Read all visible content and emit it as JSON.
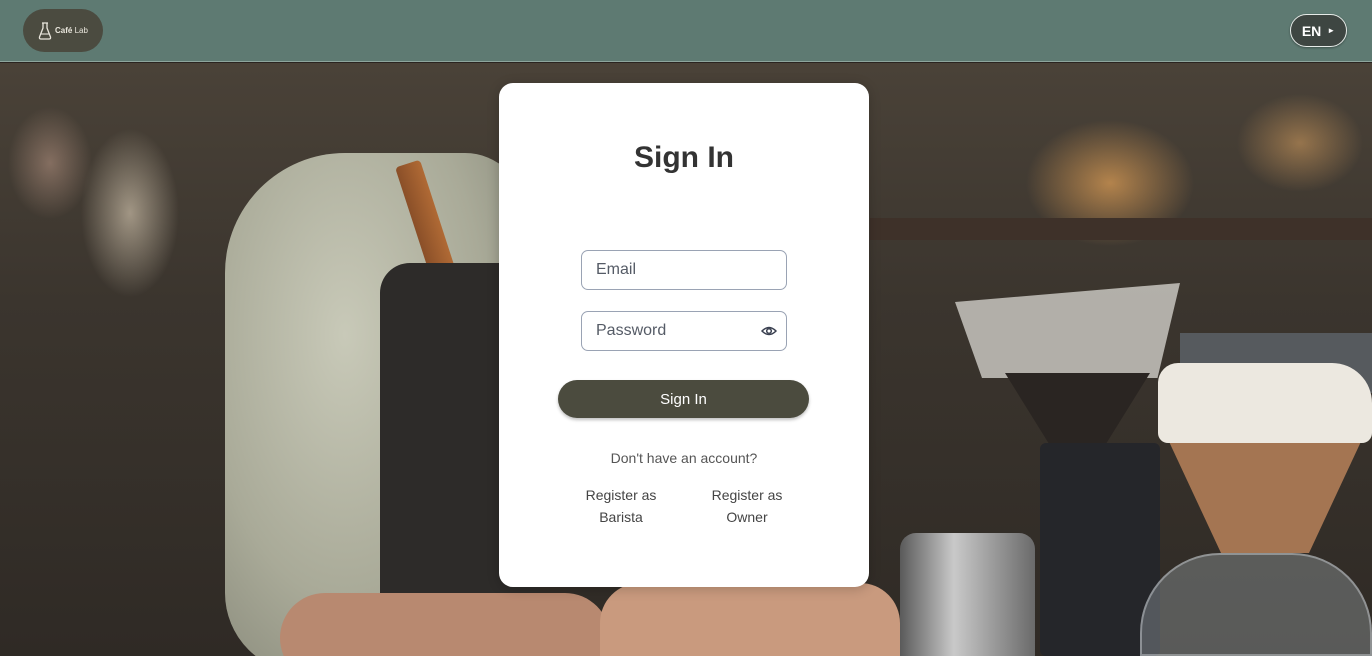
{
  "header": {
    "logo": {
      "brand": "Café",
      "suffix": "Lab",
      "icon": "coffee-flask-icon"
    },
    "language_label": "EN",
    "language_icon": "caret-right-icon"
  },
  "colors": {
    "header_bg": "#5e7a72",
    "logo_bg": "#4b4b40",
    "button_bg": "#4b4b3e",
    "card_bg": "#ffffff"
  },
  "signin": {
    "title": "Sign In",
    "email_placeholder": "Email",
    "password_placeholder": "Password",
    "password_toggle_icon": "eye-icon",
    "submit_label": "Sign In",
    "no_account_text": "Don't have an account?",
    "register_barista_line1": "Register as",
    "register_barista_line2": "Barista",
    "register_owner_line1": "Register as",
    "register_owner_line2": "Owner"
  }
}
